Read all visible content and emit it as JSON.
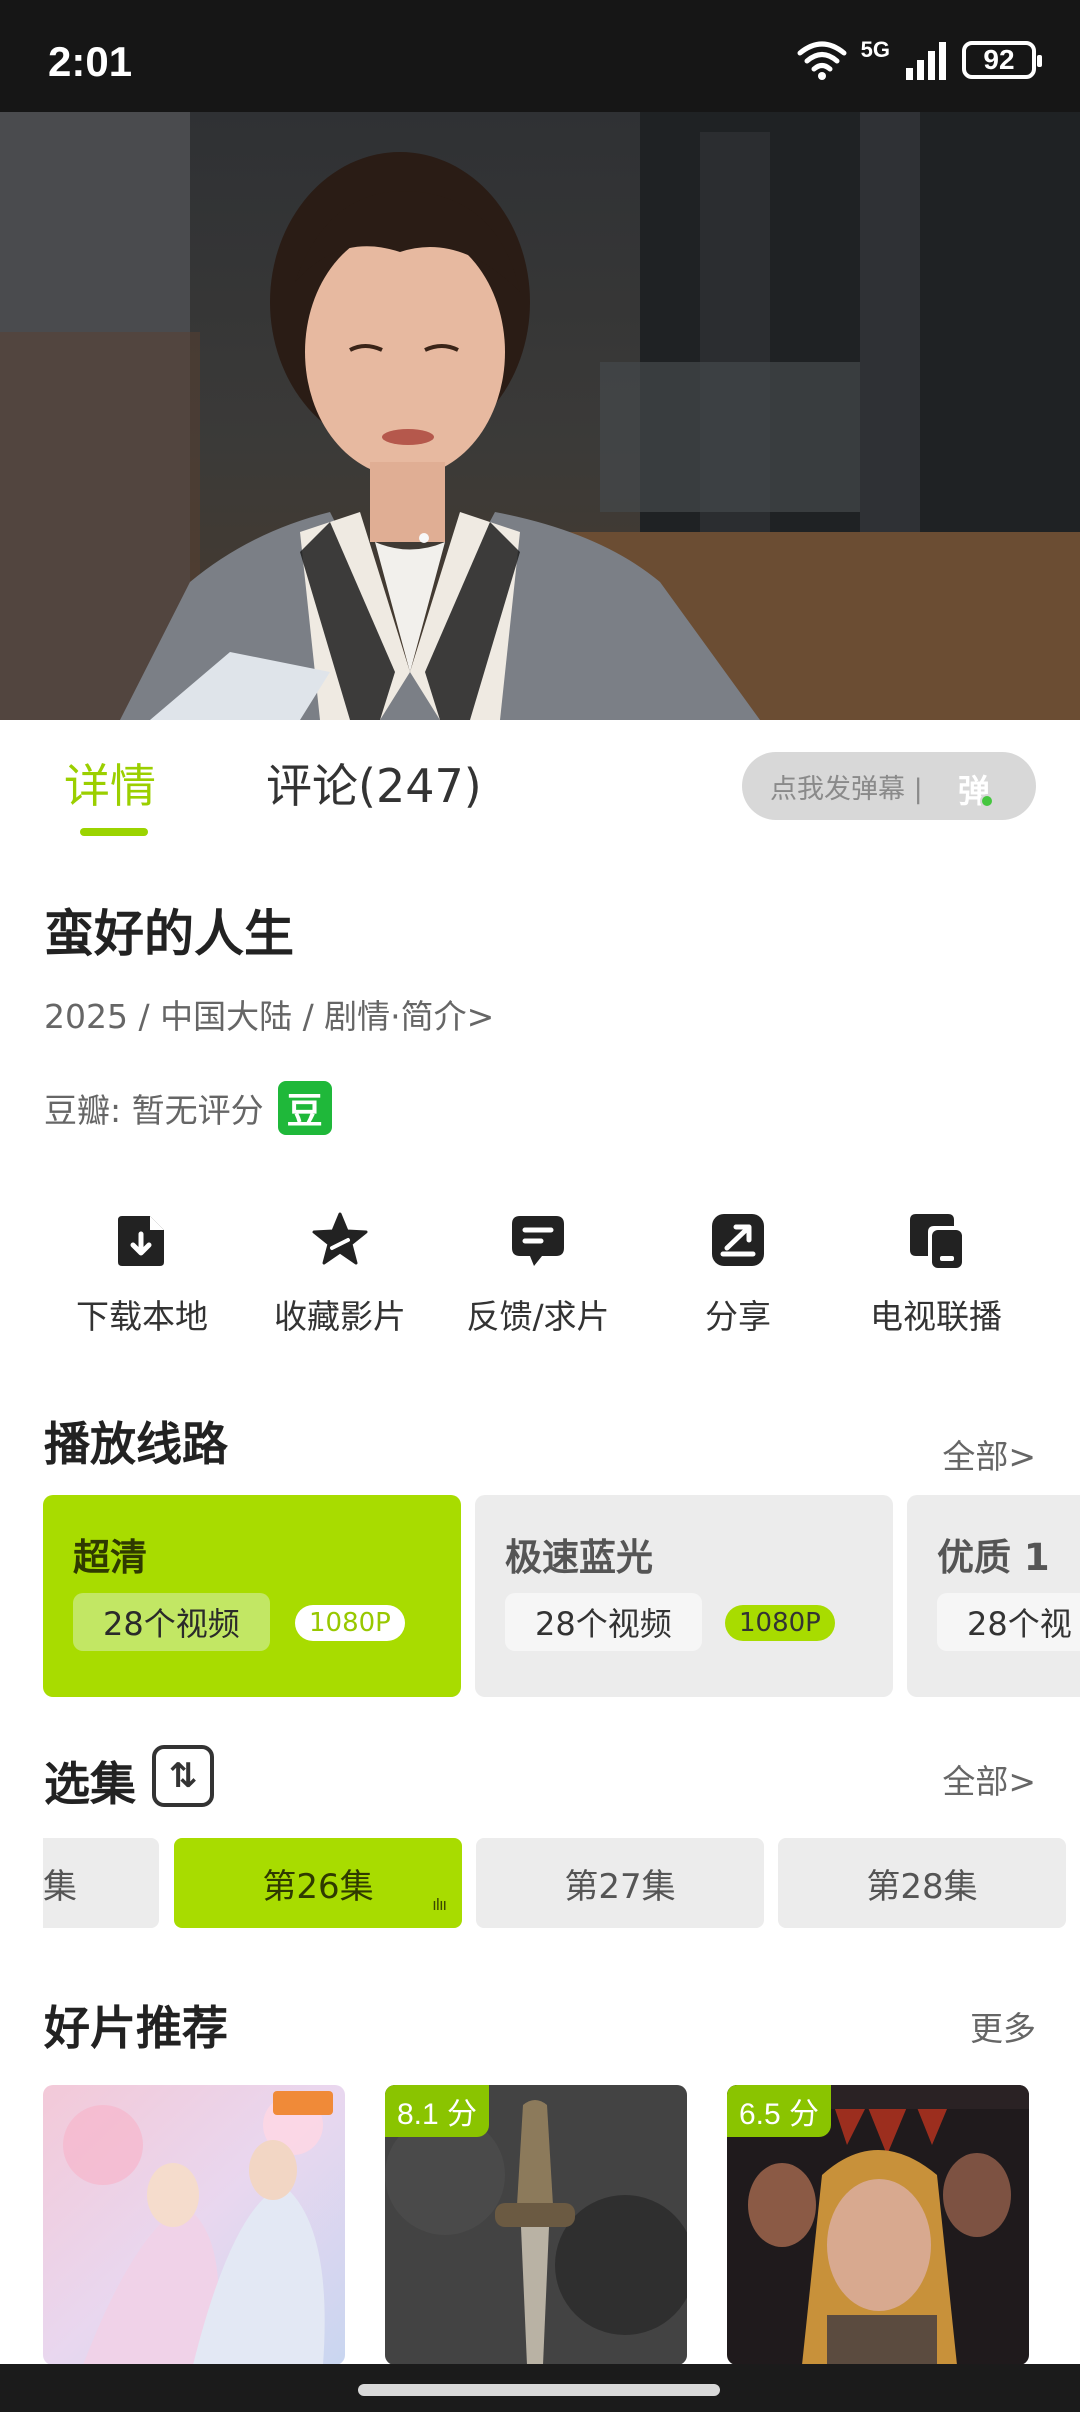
{
  "status_bar": {
    "time": "2:01",
    "network": "5G",
    "battery": "92"
  },
  "tabs": {
    "detail": "详情",
    "comments": "评论(247)",
    "danmaku_placeholder": "点我发弹幕 |",
    "danmaku_icon": "弹"
  },
  "show": {
    "title": "蛮好的人生",
    "meta": "2025 / 中国大陆 / 剧情·简介>",
    "rating_label": "豆瓣: 暂无评分",
    "douban_badge": "豆"
  },
  "actions": [
    {
      "label": "下载本地",
      "icon": "download-icon"
    },
    {
      "label": "收藏影片",
      "icon": "star-icon"
    },
    {
      "label": "反馈/求片",
      "icon": "feedback-icon"
    },
    {
      "label": "分享",
      "icon": "share-icon"
    },
    {
      "label": "电视联播",
      "icon": "cast-icon"
    }
  ],
  "lines": {
    "title": "播放线路",
    "more": "全部>",
    "items": [
      {
        "name": "超清",
        "count": "28个视频",
        "quality": "1080P",
        "active": true
      },
      {
        "name": "极速蓝光",
        "count": "28个视频",
        "quality": "1080P",
        "active": false
      },
      {
        "name": "优质 1",
        "count": "28个视",
        "quality": "",
        "active": false
      }
    ]
  },
  "episodes": {
    "title": "选集",
    "sort_icon": "sort-icon",
    "more": "全部>",
    "items": [
      {
        "label": "集",
        "active": false
      },
      {
        "label": "第26集",
        "active": true
      },
      {
        "label": "第27集",
        "active": false
      },
      {
        "label": "第28集",
        "active": false
      }
    ]
  },
  "recommendations": {
    "title": "好片推荐",
    "more": "更多",
    "items": [
      {
        "score": ""
      },
      {
        "score": "8.1 分"
      },
      {
        "score": "6.5 分"
      }
    ]
  },
  "colors": {
    "accent": "#a8dc00",
    "accent_text": "#9bcf00",
    "douban_green": "#1fb83a"
  }
}
